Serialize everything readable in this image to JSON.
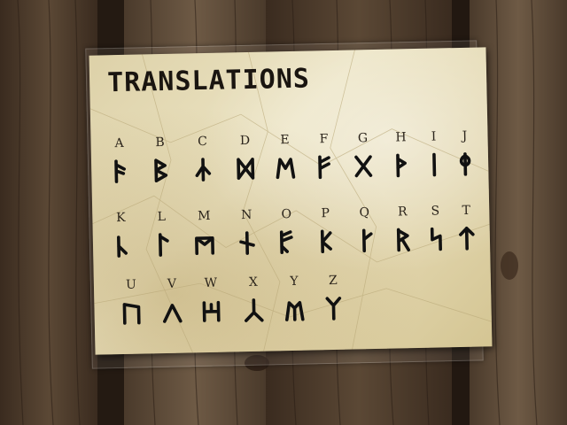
{
  "sign": {
    "title": "TRANSLATIONS",
    "rows": [
      [
        {
          "letter": "A",
          "rune": "rune-a-icon"
        },
        {
          "letter": "B",
          "rune": "rune-b-icon"
        },
        {
          "letter": "C",
          "rune": "rune-c-icon"
        },
        {
          "letter": "D",
          "rune": "rune-d-icon"
        },
        {
          "letter": "E",
          "rune": "rune-e-icon"
        },
        {
          "letter": "F",
          "rune": "rune-f-icon"
        },
        {
          "letter": "G",
          "rune": "rune-g-icon"
        },
        {
          "letter": "H",
          "rune": "rune-h-icon"
        },
        {
          "letter": "I",
          "rune": "rune-i-icon"
        },
        {
          "letter": "J",
          "rune": "rune-j-icon"
        }
      ],
      [
        {
          "letter": "K",
          "rune": "rune-k-icon"
        },
        {
          "letter": "L",
          "rune": "rune-l-icon"
        },
        {
          "letter": "M",
          "rune": "rune-m-icon"
        },
        {
          "letter": "N",
          "rune": "rune-n-icon"
        },
        {
          "letter": "O",
          "rune": "rune-o-icon"
        },
        {
          "letter": "P",
          "rune": "rune-p-icon"
        },
        {
          "letter": "Q",
          "rune": "rune-q-icon"
        },
        {
          "letter": "R",
          "rune": "rune-r-icon"
        },
        {
          "letter": "S",
          "rune": "rune-s-icon"
        },
        {
          "letter": "T",
          "rune": "rune-t-icon"
        }
      ],
      [
        {
          "letter": "U",
          "rune": "rune-u-icon"
        },
        {
          "letter": "V",
          "rune": "rune-v-icon"
        },
        {
          "letter": "W",
          "rune": "rune-w-icon"
        },
        {
          "letter": "X",
          "rune": "rune-x-icon"
        },
        {
          "letter": "Y",
          "rune": "rune-y-icon"
        },
        {
          "letter": "Z",
          "rune": "rune-z-icon"
        }
      ]
    ]
  },
  "colors": {
    "wood_dark": "#3d2d20",
    "wood_light": "#6b5642",
    "paper": "#e6dcb8",
    "ink": "#111111"
  }
}
